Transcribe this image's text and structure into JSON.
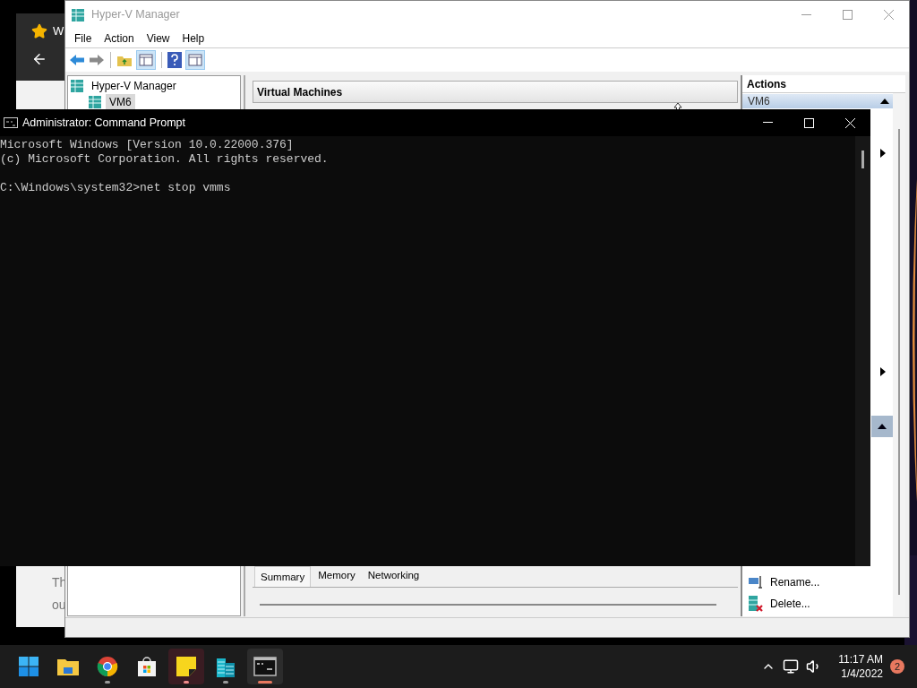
{
  "browser_window": {
    "title_fragment": "W",
    "text_fragments": [
      "Th",
      "ou"
    ]
  },
  "hyperv": {
    "title": "Hyper-V Manager",
    "menu": [
      "File",
      "Action",
      "View",
      "Help"
    ],
    "tree": [
      {
        "label": "Hyper-V Manager",
        "selected": false,
        "children": [
          {
            "label": "VM6",
            "selected": true
          }
        ]
      }
    ],
    "center": {
      "title": "Virtual Machines",
      "tabs": [
        {
          "label": "Summary",
          "selected": true
        },
        {
          "label": "Memory",
          "selected": false
        },
        {
          "label": "Networking",
          "selected": false
        }
      ]
    },
    "actions": {
      "title": "Actions",
      "section": {
        "label": "VM6",
        "selected": true
      },
      "items": [
        {
          "label": "Rename...",
          "kind": "rename"
        },
        {
          "label": "Delete...",
          "kind": "delete"
        }
      ]
    }
  },
  "cmd": {
    "title": "Administrator: Command Prompt",
    "banner": [
      "Microsoft Windows [Version 10.0.22000.376]",
      "(c) Microsoft Corporation. All rights reserved."
    ],
    "prompt": "C:\\Windows\\system32>net stop vmms"
  },
  "taskbar": {
    "apps": [
      {
        "kind": "start",
        "running": false,
        "flashing": false,
        "selected": false
      },
      {
        "kind": "folder",
        "running": false,
        "flashing": false,
        "selected": false
      },
      {
        "kind": "browser",
        "running": true,
        "flashing": false,
        "selected": false
      },
      {
        "kind": "store",
        "running": false,
        "flashing": false,
        "selected": false
      },
      {
        "kind": "note",
        "running": true,
        "flashing": true,
        "selected": false
      },
      {
        "kind": "buildings",
        "running": true,
        "flashing": false,
        "selected": false
      },
      {
        "kind": "terminal",
        "running": true,
        "flashing": false,
        "selected": true
      }
    ],
    "time": "11:17 AM",
    "date": "1/4/2022",
    "notifications": "2"
  }
}
